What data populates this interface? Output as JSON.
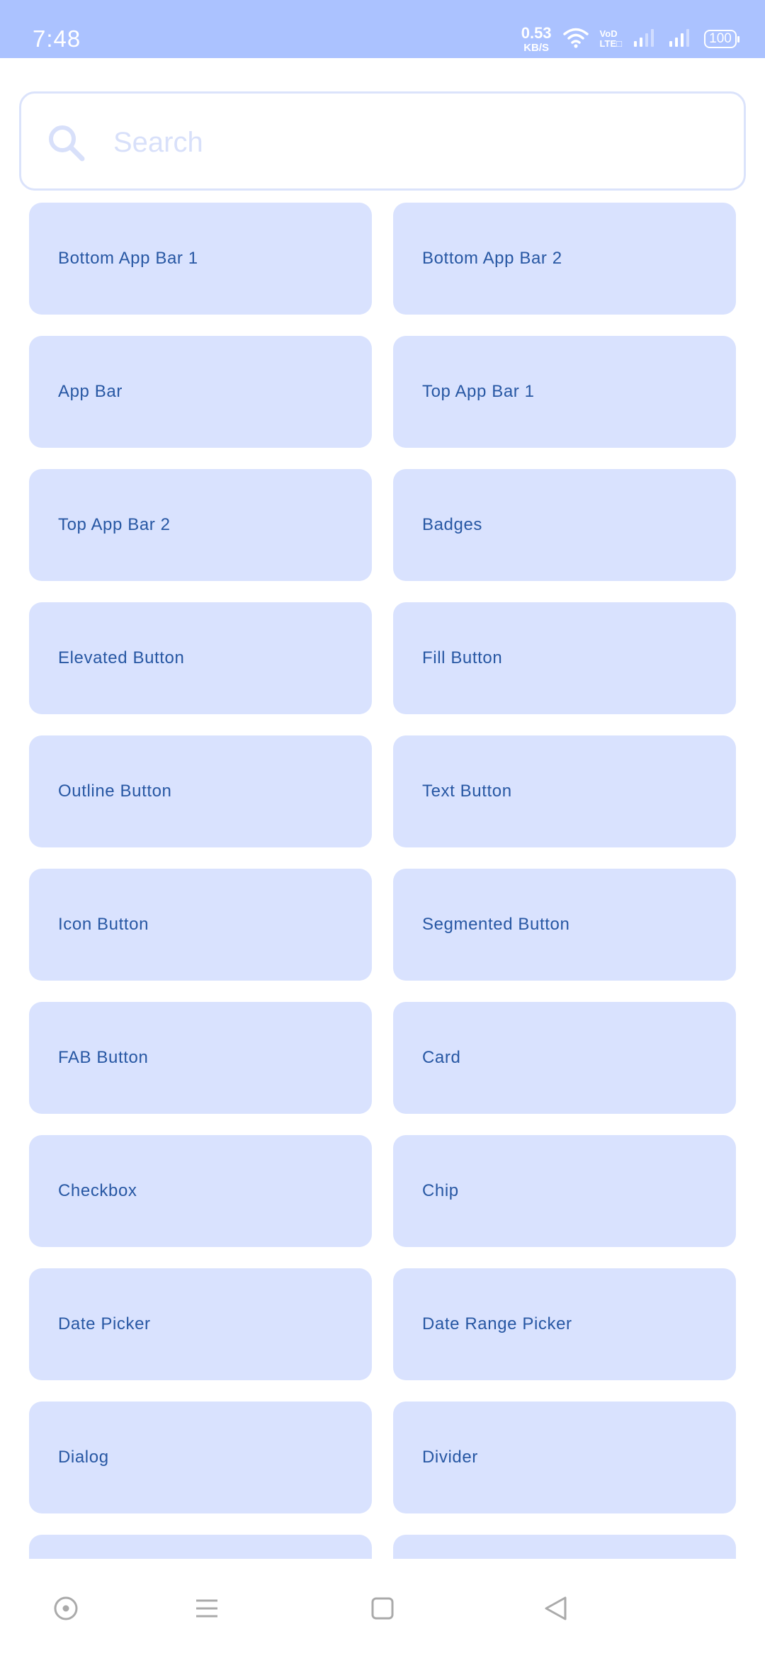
{
  "status_bar": {
    "time": "7:48",
    "net_speed": "0.53",
    "net_unit": "KB/S",
    "volte_top": "VoD",
    "volte_bottom": "LTE□",
    "battery": "100"
  },
  "search": {
    "placeholder": "Search",
    "value": ""
  },
  "components": [
    "Bottom App Bar 1",
    "Bottom App Bar 2",
    "App Bar",
    "Top App Bar 1",
    "Top App Bar 2",
    "Badges",
    "Elevated Button",
    "Fill Button",
    "Outline Button",
    "Text Button",
    "Icon Button",
    "Segmented Button",
    "FAB Button",
    "Card",
    "Checkbox",
    "Chip",
    "Date Picker",
    "Date Range Picker",
    "Dialog",
    "Divider",
    "",
    ""
  ],
  "icons": {
    "search": "search-icon",
    "nav_home": "circle-dot-icon",
    "nav_menu": "menu-icon",
    "nav_recent": "square-icon",
    "nav_back": "back-triangle-icon"
  },
  "colors": {
    "status_bar": "#abc2ff",
    "card_bg": "#d9e2fe",
    "card_text": "#2757a3",
    "search_border": "#dbe3fb",
    "nav_icon": "#aaaaaa"
  }
}
